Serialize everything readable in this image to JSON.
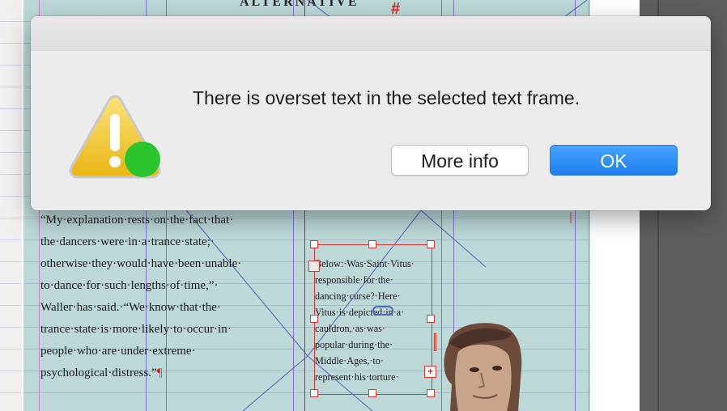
{
  "document": {
    "headline": "ALTERNATIVE",
    "hash_mark": "#",
    "body_lines": [
      "“My·explanation·rests·on·the·fact·that·",
      "the·dancers·were·in·a·trance·state;·",
      "otherwise·they·would·have·been·unable·",
      "to·dance·for·such·lengths·of·time,”·",
      "Waller·has·said.·“We·know·that·the·",
      "trance·state·is·more·likely·to·occur·in·",
      "people·who·are·under·extreme·",
      "psychological·distress.”"
    ],
    "body_end_mark": "¶",
    "caption_lines": [
      "Below:·Was·Saint·Vitus·",
      "responsible·for·the·",
      "dancing·curse?·Here·",
      "Vitus·is·depicted·in·a·",
      "cauldron,·as·was·",
      "popular·during·the·",
      "Middle·Ages,·to·",
      "represent·his·torture·"
    ],
    "overset_symbol": "+"
  },
  "dialog": {
    "message": "There is overset text in the selected text frame.",
    "more_info_label": "More info",
    "ok_label": "OK"
  },
  "colors": {
    "ok_button": "#1f7ef2",
    "warning": "#f0c419",
    "badge": "#2ac52e",
    "frame": "#d33333"
  }
}
